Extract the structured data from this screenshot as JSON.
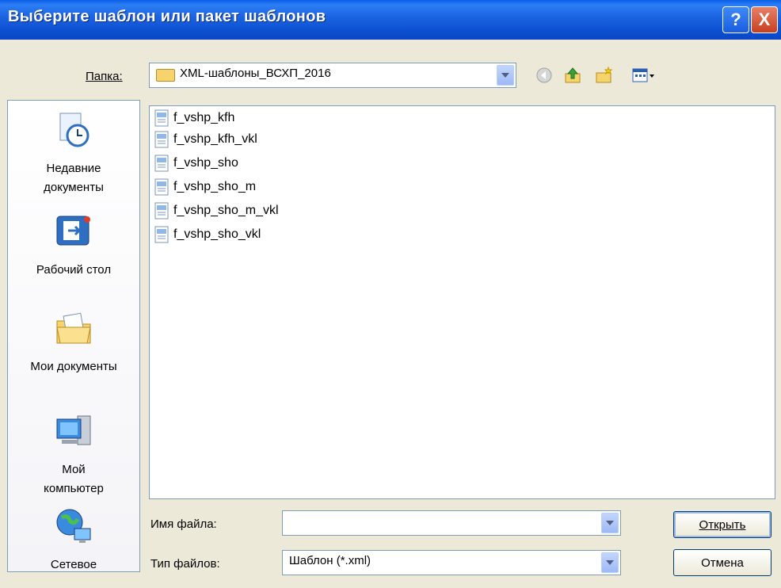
{
  "window": {
    "title": "Выберите шаблон или пакет шаблонов",
    "help_glyph": "?",
    "close_glyph": "X"
  },
  "location": {
    "label": "Папка:",
    "current_folder": "XML-шаблоны_ВСХП_2016"
  },
  "places": [
    {
      "label_line1": "Недавние",
      "label_line2": "документы",
      "icon": "recent-documents-icon"
    },
    {
      "label_line1": "Рабочий стол",
      "label_line2": "",
      "icon": "desktop-icon"
    },
    {
      "label_line1": "Мои документы",
      "label_line2": "",
      "icon": "my-documents-icon"
    },
    {
      "label_line1": "Мой",
      "label_line2": "компьютер",
      "icon": "my-computer-icon"
    },
    {
      "label_line1": "Сетевое",
      "label_line2": "",
      "icon": "network-icon"
    }
  ],
  "files": [
    "f_vshp_kfh",
    "f_vshp_kfh_vkl",
    "f_vshp_sho",
    "f_vshp_sho_m",
    "f_vshp_sho_m_vkl",
    "f_vshp_sho_vkl"
  ],
  "filename": {
    "label": "Имя файла:",
    "value": ""
  },
  "filetype": {
    "label": "Тип файлов:",
    "value": "Шаблон (*.xml)"
  },
  "buttons": {
    "open": "Открыть",
    "cancel": "Отмена"
  },
  "colors": {
    "titlebar": "#0a5ee8",
    "dialog_bg": "#ece9d8",
    "border": "#7f9db9"
  }
}
